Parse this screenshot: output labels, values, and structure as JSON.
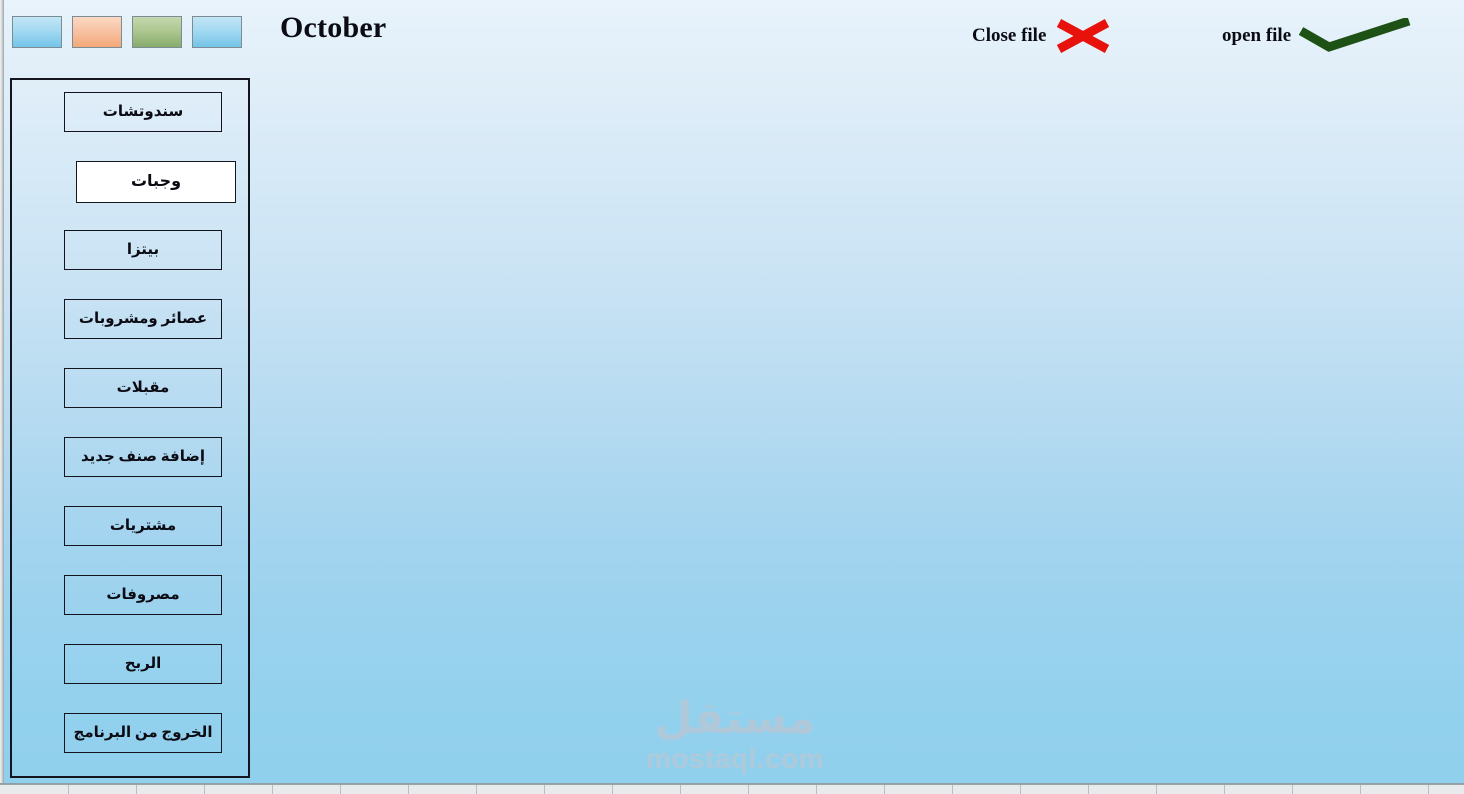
{
  "window": {
    "title": "October",
    "background_top_color": "#e8f3fb",
    "background_bottom_color": "#90d0ed"
  },
  "palette": {
    "swatches": [
      {
        "name": "swatch-blue-1",
        "color": "#a4daf2"
      },
      {
        "name": "swatch-orange",
        "color": "#f8c3a4"
      },
      {
        "name": "swatch-green",
        "color": "#aec892"
      },
      {
        "name": "swatch-blue-2",
        "color": "#a4daf2"
      }
    ]
  },
  "header": {
    "month_label": "October",
    "actions": [
      {
        "label": "Close file",
        "icon": "x-icon",
        "icon_color": "#e8120c"
      },
      {
        "label": "open file",
        "icon": "check-icon",
        "icon_color": "#1e5115"
      }
    ]
  },
  "sidebar": {
    "items": [
      {
        "label": "سندوتشات",
        "name": "sidebar-item-sandwiches",
        "selected": false
      },
      {
        "label": "وجبات",
        "name": "sidebar-item-meals",
        "selected": true
      },
      {
        "label": "بيتزا",
        "name": "sidebar-item-pizza",
        "selected": false
      },
      {
        "label": "عصائر ومشروبات",
        "name": "sidebar-item-drinks",
        "selected": false
      },
      {
        "label": "مقبلات",
        "name": "sidebar-item-appetizers",
        "selected": false
      },
      {
        "label": "إضافة صنف جديد",
        "name": "sidebar-item-add-item",
        "selected": false
      },
      {
        "label": "مشتريات",
        "name": "sidebar-item-purchases",
        "selected": false
      },
      {
        "label": "مصروفات",
        "name": "sidebar-item-expenses",
        "selected": false
      },
      {
        "label": "الربح",
        "name": "sidebar-item-profit",
        "selected": false
      },
      {
        "label": "الخروج من البرنامج",
        "name": "sidebar-item-exit",
        "selected": false
      }
    ]
  },
  "watermark": {
    "arabic": "مستقل",
    "latin": "mostaql.com"
  }
}
